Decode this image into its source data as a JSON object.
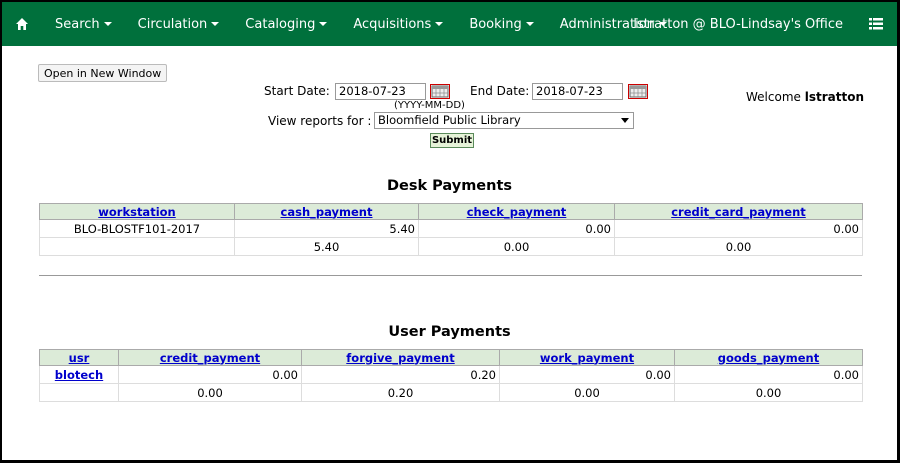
{
  "navbar": {
    "home_icon": "home-icon",
    "menus": [
      "Search",
      "Circulation",
      "Cataloging",
      "Acquisitions",
      "Booking",
      "Administration"
    ],
    "user": "lstratton @ BLO-Lindsay's Office",
    "list_icon": "list-icon"
  },
  "toolbar": {
    "open_new_window": "Open in New Window"
  },
  "form": {
    "start_label": "Start Date:",
    "start_value": "2018-07-23",
    "end_label": "End Date:",
    "end_value": "2018-07-23",
    "date_format": "(YYYY-MM-DD)",
    "view_label": "View reports for :",
    "library": "Bloomfield Public Library",
    "submit": "Submit"
  },
  "welcome": {
    "prefix": "Welcome",
    "user": "lstratton"
  },
  "desk_payments": {
    "title": "Desk Payments",
    "headers": [
      "workstation",
      "cash_payment",
      "check_payment",
      "credit_card_payment"
    ],
    "row": [
      "BLO-BLOSTF101-2017",
      "5.40",
      "0.00",
      "0.00"
    ],
    "totals": [
      "",
      "5.40",
      "0.00",
      "0.00"
    ]
  },
  "user_payments": {
    "title": "User Payments",
    "headers": [
      "usr",
      "credit_payment",
      "forgive_payment",
      "work_payment",
      "goods_payment"
    ],
    "row": [
      "blotech",
      "0.00",
      "0.20",
      "0.00",
      "0.00"
    ],
    "totals": [
      "",
      "0.00",
      "0.20",
      "0.00",
      "0.00"
    ]
  }
}
